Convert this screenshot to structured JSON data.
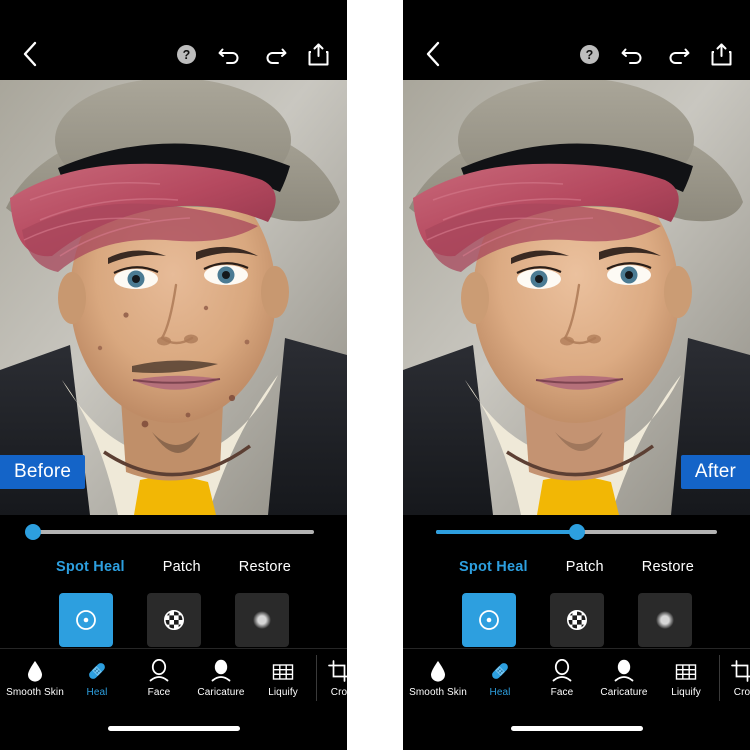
{
  "app": {
    "accent_blue": "#2d9fdf",
    "badge_blue": "#1464c8",
    "panel_bg": "#000000",
    "tile_bg": "#2a2a2a",
    "track_gray": "#b3b3b3"
  },
  "topnav": {
    "back_icon": "chevron-left-icon",
    "help_icon": "help-circle-icon",
    "undo_icon": "undo-arrow-icon",
    "redo_icon": "redo-arrow-icon",
    "share_icon": "share-export-icon"
  },
  "panels": [
    {
      "id": "before",
      "badge_label": "Before",
      "badge_side": "left",
      "slider": {
        "value": 0,
        "fill_percent": 0,
        "knob_percent": 0
      }
    },
    {
      "id": "after",
      "badge_label": "After",
      "badge_side": "right",
      "slider": {
        "value": 50,
        "fill_percent": 50,
        "knob_percent": 50
      }
    }
  ],
  "modes": [
    {
      "label": "Spot Heal",
      "active": true
    },
    {
      "label": "Patch",
      "active": false
    },
    {
      "label": "Restore",
      "active": false
    }
  ],
  "options": [
    {
      "label": "Brush",
      "icon": "brush-target-icon",
      "selected": true
    },
    {
      "label": "Opacity",
      "icon": "opacity-checker-icon",
      "selected": false
    },
    {
      "label": "Feather",
      "icon": "feather-soft-dot-icon",
      "selected": false
    }
  ],
  "toolbar": [
    {
      "label": "Smooth Skin",
      "icon": "droplet-icon",
      "active": false
    },
    {
      "label": "Heal",
      "icon": "bandage-icon",
      "active": true
    },
    {
      "label": "Face",
      "icon": "face-outline-icon",
      "active": false
    },
    {
      "label": "Caricature",
      "icon": "caricature-face-icon",
      "active": false
    },
    {
      "label": "Liquify",
      "icon": "grid-mesh-icon",
      "active": false
    },
    {
      "label": "Cro",
      "icon": "crop-icon",
      "active": false,
      "clipped": true
    }
  ],
  "home_indicator": "home-indicator-bar"
}
